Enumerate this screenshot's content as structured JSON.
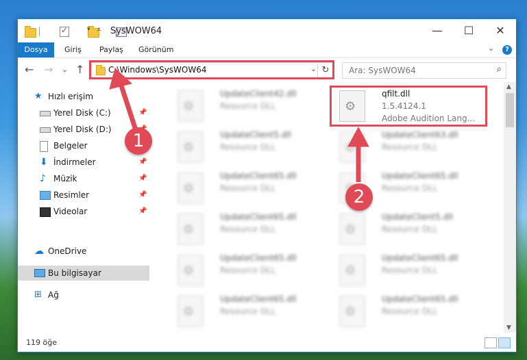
{
  "window": {
    "title": "SysWOW64",
    "minimize": "—",
    "maximize": "☐",
    "close": "✕"
  },
  "ribbon": {
    "tabs": [
      "Dosya",
      "Giriş",
      "Paylaş",
      "Görünüm"
    ],
    "help": "?",
    "collapse": "⌄"
  },
  "nav": {
    "back": "←",
    "forward": "→",
    "recent": "⌄",
    "up": "↑",
    "address": "C:\\Windows\\SysWOW64",
    "address_dropdown": "⌄",
    "refresh": "↻",
    "search_placeholder": "Ara: SysWOW64",
    "search_icon": "⌕"
  },
  "sidebar": {
    "items": [
      {
        "label": "Hızlı erişim",
        "icon": "star-icon"
      },
      {
        "label": "Yerel Disk (C:)",
        "icon": "drive-icon",
        "pinned": true
      },
      {
        "label": "Yerel Disk (D:)",
        "icon": "drive-icon",
        "pinned": true
      },
      {
        "label": "Belgeler",
        "icon": "documents-icon",
        "pinned": true
      },
      {
        "label": "İndirmeler",
        "icon": "download-icon",
        "pinned": true
      },
      {
        "label": "Müzik",
        "icon": "music-icon",
        "pinned": true
      },
      {
        "label": "Resimler",
        "icon": "pictures-icon",
        "pinned": true
      },
      {
        "label": "Videolar",
        "icon": "videos-icon",
        "pinned": true
      },
      {
        "label": "OneDrive",
        "icon": "cloud-icon"
      },
      {
        "label": "Bu bilgisayar",
        "icon": "computer-icon"
      },
      {
        "label": "Ağ",
        "icon": "network-icon"
      }
    ],
    "pin_glyph": "📌"
  },
  "files": {
    "left": [
      {
        "name": "UpdateClient42.dll",
        "type": "Resource DLL"
      },
      {
        "name": "UpdateClient5.dll",
        "type": "Resource DLL"
      },
      {
        "name": "UpdateClient65.dll",
        "type": "Resource DLL"
      },
      {
        "name": "UpdateClient65.dll",
        "type": "Resource DLL"
      },
      {
        "name": "UpdateClient65.dll",
        "type": "Resource DLL"
      },
      {
        "name": "UpdateClient65.dll",
        "type": "Resource DLL"
      }
    ],
    "right": [
      {
        "name": "qfilt.dll",
        "version": "1.5.4124.1",
        "desc": "Adobe Audition Lang..."
      },
      {
        "name": "UpdateClient63.dll",
        "type": "Resource DLL"
      },
      {
        "name": "UpdateClient65.dll",
        "type": "Resource DLL"
      },
      {
        "name": "UpdateClient5.dll",
        "type": "Resource DLL"
      },
      {
        "name": "UpdateClient65.dll",
        "type": "Resource DLL"
      },
      {
        "name": "UpdateClient65.dll",
        "type": "Resource DLL"
      }
    ]
  },
  "status": {
    "count": "119 öğe"
  },
  "annotations": {
    "badge1": "1",
    "badge2": "2",
    "color": "#e04a56"
  }
}
